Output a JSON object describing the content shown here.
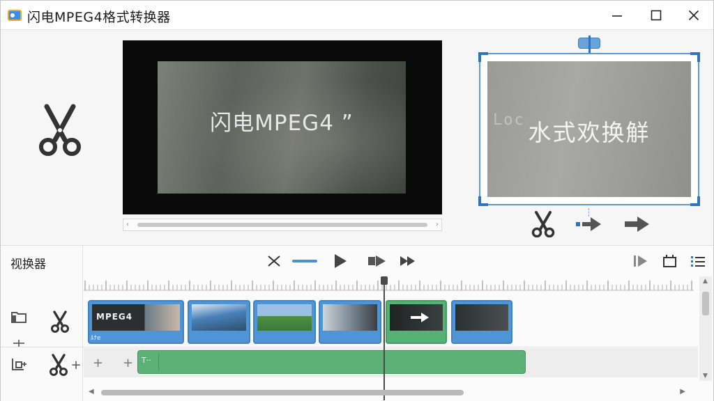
{
  "window": {
    "title": "闪电MPEG4格式转换器",
    "minimize_icon": "minimize-icon",
    "maximize_icon": "maximize-icon",
    "close_icon": "close-icon"
  },
  "preview": {
    "player_caption": "闪电MPEG4 ”",
    "crop_caption": "水式欢换觧",
    "crop_ghost_text": "Loc",
    "tools": [
      "scissors-icon",
      "convert-arrow-icon",
      "next-arrow-icon"
    ]
  },
  "timeline": {
    "label": "视换器",
    "toolbar_left": [
      "trim-icon",
      "line-icon",
      "play-icon",
      "step-forward-icon",
      "fast-forward-icon"
    ],
    "toolbar_right": [
      "skip-end-icon",
      "snapshot-icon",
      "list-icon"
    ],
    "clips": [
      {
        "thumb_text": "MPEG4",
        "footer": "ﾙﾅe",
        "color": "blue"
      },
      {
        "thumb_text": "",
        "footer": "",
        "color": "blue"
      },
      {
        "thumb_text": "",
        "footer": "",
        "color": "blue"
      },
      {
        "thumb_text": "",
        "footer": "",
        "color": "blue"
      },
      {
        "thumb_text": "",
        "footer": "",
        "color": "green"
      },
      {
        "thumb_text": "",
        "footer": "",
        "color": "blue"
      }
    ],
    "audio_track_head": "T··",
    "add_symbols": [
      "+",
      "+",
      "+"
    ]
  },
  "colors": {
    "accent_blue": "#4f95d6",
    "clip_green": "#55b274",
    "crop_border": "#5b9bd5"
  }
}
